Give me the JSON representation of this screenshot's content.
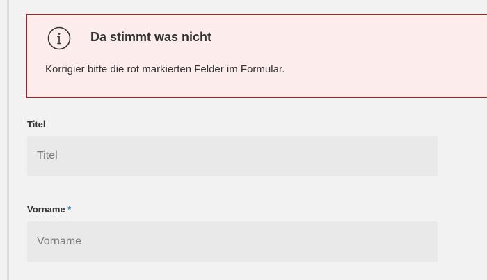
{
  "error_banner": {
    "icon": "info-icon",
    "title": "Da stimmt was nicht",
    "message": "Korrigier bitte die rot markierten Felder im Formular.",
    "border_color": "#a81f1f",
    "background_color": "#fdecec"
  },
  "form": {
    "fields": [
      {
        "label": "Titel",
        "required_marker": "",
        "value": "",
        "placeholder": "Titel"
      },
      {
        "label": "Vorname",
        "required_marker": "*",
        "value": "",
        "placeholder": "Vorname"
      }
    ],
    "required_marker_color": "#1a73a8"
  }
}
